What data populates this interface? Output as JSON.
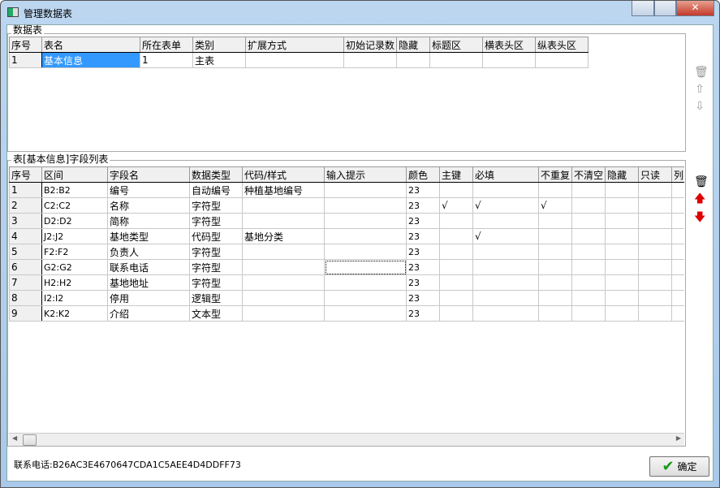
{
  "window": {
    "title": "管理数据表"
  },
  "tables_group": {
    "legend": "数据表",
    "columns": [
      "序号",
      "表名",
      "所在表单",
      "类别",
      "扩展方式",
      "初始记录数",
      "隐藏",
      "标题区",
      "横表头区",
      "纵表头区"
    ],
    "rows": [
      [
        "1",
        "基本信息",
        "1",
        "主表",
        "",
        "",
        "",
        "",
        "",
        ""
      ]
    ]
  },
  "fields_group": {
    "legend": "表[基本信息]字段列表",
    "columns": [
      "序号",
      "区间",
      "字段名",
      "数据类型",
      "代码/样式",
      "输入提示",
      "颜色",
      "主键",
      "必填",
      "不重复",
      "不清空",
      "隐藏",
      "只读",
      "列"
    ],
    "rows": [
      [
        "1",
        "B2:B2",
        "编号",
        "自动编号",
        "种植基地编号",
        "",
        "23",
        "",
        "",
        "",
        "",
        "",
        "",
        ""
      ],
      [
        "2",
        "C2:C2",
        "名称",
        "字符型",
        "",
        "",
        "23",
        "√",
        "√",
        "√",
        "",
        "",
        "",
        ""
      ],
      [
        "3",
        "D2:D2",
        "简称",
        "字符型",
        "",
        "",
        "23",
        "",
        "",
        "",
        "",
        "",
        "",
        ""
      ],
      [
        "4",
        "J2:J2",
        "基地类型",
        "代码型",
        "基地分类",
        "",
        "23",
        "",
        "√",
        "",
        "",
        "",
        "",
        ""
      ],
      [
        "5",
        "F2:F2",
        "负责人",
        "字符型",
        "",
        "",
        "23",
        "",
        "",
        "",
        "",
        "",
        "",
        ""
      ],
      [
        "6",
        "G2:G2",
        "联系电话",
        "字符型",
        "",
        "",
        "23",
        "",
        "",
        "",
        "",
        "",
        "",
        ""
      ],
      [
        "7",
        "H2:H2",
        "基地地址",
        "字符型",
        "",
        "",
        "23",
        "",
        "",
        "",
        "",
        "",
        "",
        ""
      ],
      [
        "8",
        "I2:I2",
        "停用",
        "逻辑型",
        "",
        "",
        "23",
        "",
        "",
        "",
        "",
        "",
        "",
        ""
      ],
      [
        "9",
        "K2:K2",
        "介绍",
        "文本型",
        "",
        "",
        "23",
        "",
        "",
        "",
        "",
        "",
        "",
        ""
      ]
    ]
  },
  "footer": {
    "label": "联系电话:",
    "value": "B26AC3E4670647CDA1C5AEE4D4DDFF73"
  },
  "ok_label": "确定",
  "icons": {
    "delete": "trash-icon",
    "up": "arrow-up-icon",
    "down": "arrow-down-icon"
  }
}
